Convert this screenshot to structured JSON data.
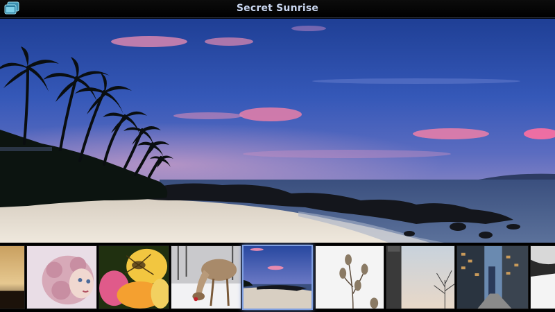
{
  "window": {
    "title": "Secret Sunrise",
    "app_icon": "photo-stack-icon"
  },
  "viewer": {
    "image_subject": "sunrise-beach-palms"
  },
  "filmstrip": {
    "selected_index": 4,
    "thumbnails": [
      {
        "subject": "sunset-edge"
      },
      {
        "subject": "doll"
      },
      {
        "subject": "flower-spider"
      },
      {
        "subject": "deer-snow"
      },
      {
        "subject": "sunrise-beach"
      },
      {
        "subject": "dried-seed-pods"
      },
      {
        "subject": "tower-tree"
      },
      {
        "subject": "city-street"
      },
      {
        "subject": "snowy-edge"
      }
    ]
  },
  "colors": {
    "title_text": "#c9d6ef",
    "selection_border": "#7f9fe0"
  }
}
